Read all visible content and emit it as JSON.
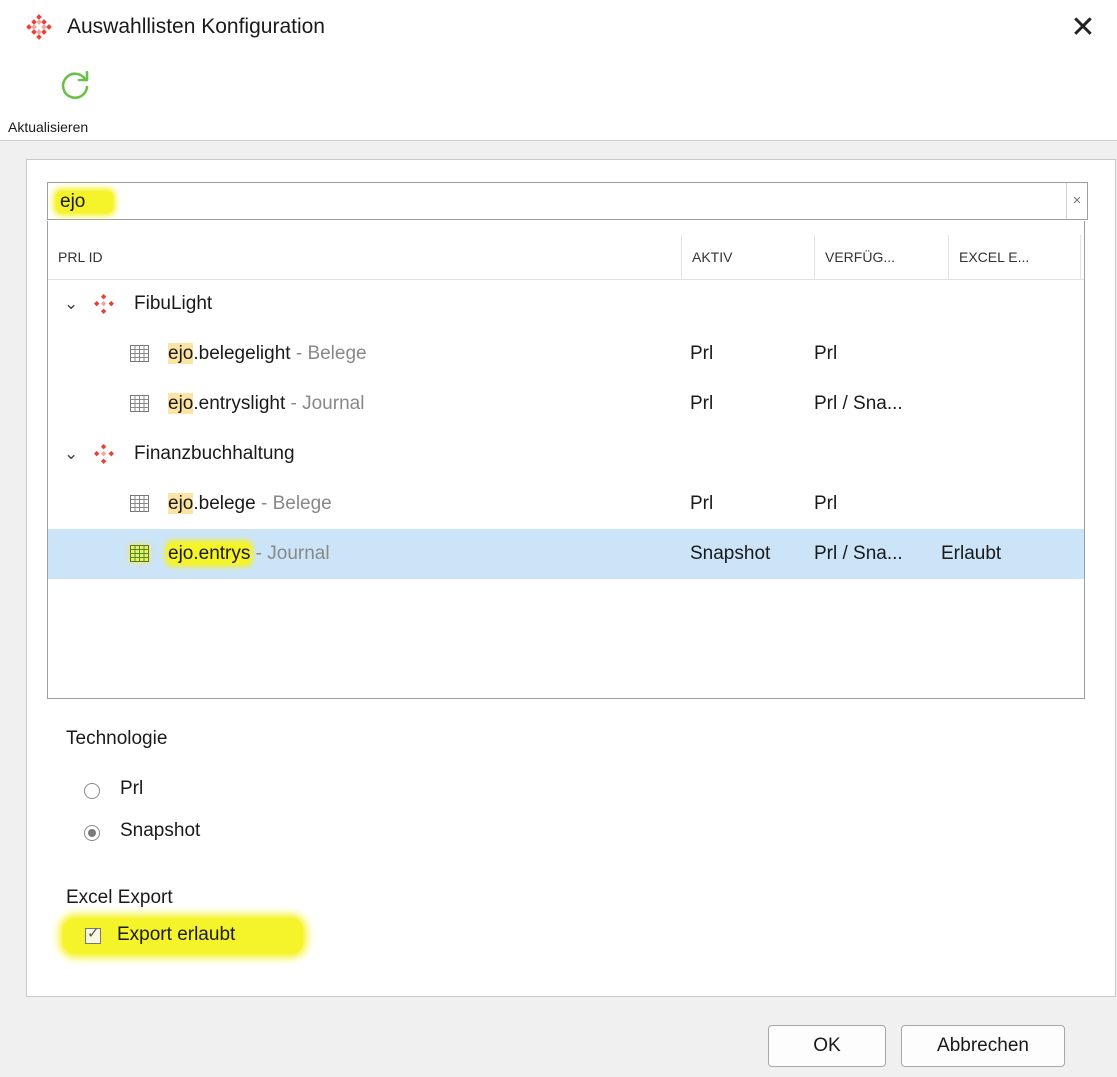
{
  "window": {
    "title": "Auswahllisten Konfiguration"
  },
  "toolbar": {
    "refresh_label": "Aktualisieren"
  },
  "search": {
    "value": "ejo"
  },
  "table": {
    "columns": [
      "PRL ID",
      "AKTIV",
      "VERFÜG...",
      "EXCEL E..."
    ],
    "groups": [
      {
        "label": "FibuLight",
        "items": [
          {
            "match": "ejo",
            "rest": ".belegelight",
            "desc": " - Belege",
            "aktiv": "Prl",
            "verf": "Prl",
            "excel": ""
          },
          {
            "match": "ejo",
            "rest": ".entryslight",
            "desc": " - Journal",
            "aktiv": "Prl",
            "verf": "Prl / Sna...",
            "excel": ""
          }
        ]
      },
      {
        "label": "Finanzbuchhaltung",
        "items": [
          {
            "match": "ejo",
            "rest": ".belege",
            "desc": " - Belege",
            "aktiv": "Prl",
            "verf": "Prl",
            "excel": ""
          },
          {
            "match": "ejo",
            "rest": ".entrys",
            "desc": " - Journal",
            "aktiv": "Snapshot",
            "verf": "Prl / Sna...",
            "excel": "Erlaubt",
            "selected": true
          }
        ]
      }
    ]
  },
  "technologie": {
    "label": "Technologie",
    "options": [
      {
        "label": "Prl",
        "checked": false
      },
      {
        "label": "Snapshot",
        "checked": true
      }
    ]
  },
  "excel_export": {
    "label": "Excel Export",
    "checkbox_label": "Export erlaubt",
    "checked": true
  },
  "buttons": {
    "ok": "OK",
    "cancel": "Abbrechen"
  },
  "colors": {
    "accent_red": "#e8413a",
    "refresh_green": "#6cc04a",
    "highlight": "#f5f32a",
    "selection": "#cce4f7"
  }
}
